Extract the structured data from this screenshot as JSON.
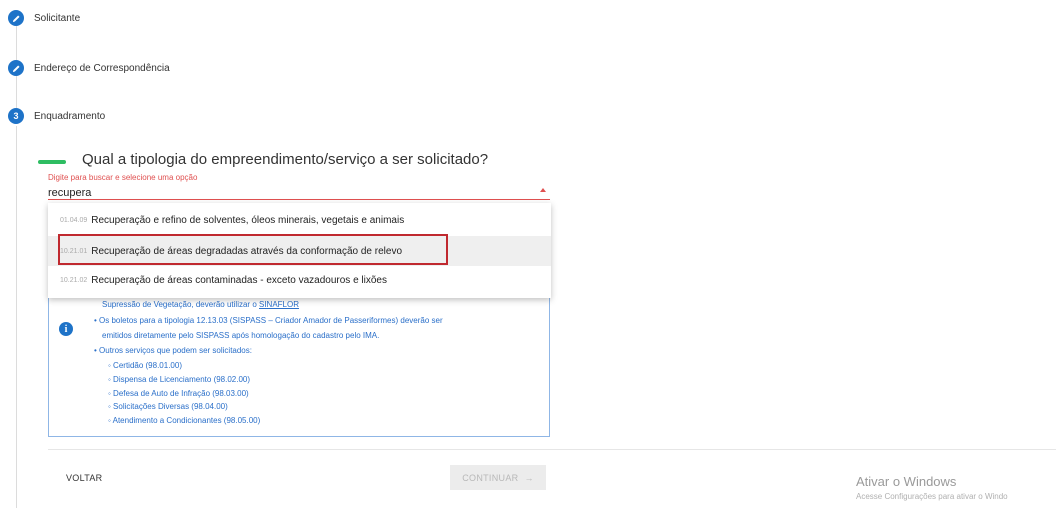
{
  "steps": [
    {
      "label": "Solicitante",
      "icon": "pencil-icon",
      "state": "done"
    },
    {
      "label": "Endereço de Correspondência",
      "icon": "pencil-icon",
      "state": "done"
    },
    {
      "label": "Enquadramento",
      "number": "3",
      "state": "active"
    }
  ],
  "question": {
    "title": "Qual a tipologia do empreendimento/serviço a ser solicitado?",
    "hint": "Digite para buscar e selecione uma opção",
    "value": "recupera"
  },
  "options": [
    {
      "code": "01.04.09",
      "label": "Recuperação e refino de solventes, óleos minerais, vegetais e animais"
    },
    {
      "code": "10.21.01",
      "label": "Recuperação de áreas degradadas através da conformação de relevo"
    },
    {
      "code": "10.21.02",
      "label": "Recuperação de áreas contaminadas - exceto vazadouros e lixões"
    }
  ],
  "info": {
    "line1_prefix": "Supressão de Vegetação, deverão utilizar o ",
    "line1_link": "SINAFLOR",
    "line2": "• Os boletos para a tipologia 12.13.03 (SISPASS – Criador Amador de Passeriformes) deverão ser",
    "line3": "emitidos diretamente pelo SISPASS após homologação do cadastro pelo IMA.",
    "line4": "• Outros serviços que podem ser solicitados:",
    "services": [
      "◦ Certidão (98.01.00)",
      "◦ Dispensa de Licenciamento (98.02.00)",
      "◦ Defesa de Auto de Infração (98.03.00)",
      "◦ Solicitações Diversas (98.04.00)",
      "◦ Atendimento a Condicionantes (98.05.00)"
    ]
  },
  "actions": {
    "back": "VOLTAR",
    "continue": "CONTINUAR",
    "continue_arrow": "→"
  },
  "watermark": {
    "title": "Ativar o Windows",
    "subtitle": "Acesse Configurações para ativar o Windo"
  },
  "colors": {
    "accent": "#1e73c8",
    "error": "#e05050",
    "success": "#2ebd62",
    "highlight": "#c0292f"
  }
}
